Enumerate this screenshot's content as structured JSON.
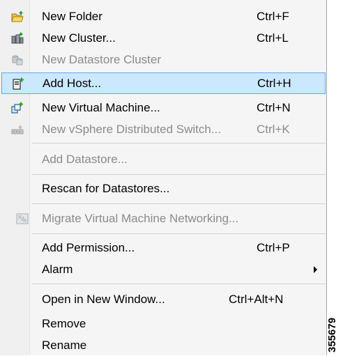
{
  "menu": {
    "items": [
      {
        "label": "New Folder",
        "shortcut": "Ctrl+F",
        "icon": "folder-icon"
      },
      {
        "label": "New Cluster...",
        "shortcut": "Ctrl+L",
        "icon": "cluster-icon"
      },
      {
        "label": "New Datastore Cluster",
        "shortcut": "",
        "icon": "datastore-cluster-icon"
      },
      {
        "label": "Add Host...",
        "shortcut": "Ctrl+H",
        "icon": "add-host-icon"
      },
      {
        "label": "New Virtual Machine...",
        "shortcut": "Ctrl+N",
        "icon": "virtual-machine-icon"
      },
      {
        "label": "New vSphere Distributed Switch...",
        "shortcut": "Ctrl+K",
        "icon": "distributed-switch-icon"
      },
      {
        "label": "Add Datastore...",
        "shortcut": ""
      },
      {
        "label": "Rescan for Datastores...",
        "shortcut": ""
      },
      {
        "label": "Migrate Virtual Machine Networking...",
        "shortcut": "",
        "icon": "migrate-network-icon"
      },
      {
        "label": "Add Permission...",
        "shortcut": "Ctrl+P"
      },
      {
        "label": "Alarm",
        "shortcut": "",
        "icon": "submenu-arrow-icon"
      },
      {
        "label": "Open in New Window...",
        "shortcut": "Ctrl+Alt+N"
      },
      {
        "label": "Remove",
        "shortcut": ""
      },
      {
        "label": "Rename",
        "shortcut": ""
      }
    ]
  },
  "figure_id": "355679",
  "colors": {
    "highlight_bg": "#cce8ff",
    "highlight_border": "#66a7e8",
    "disabled_text": "#8b8b8b",
    "menu_bg": "#f5f5f5"
  }
}
